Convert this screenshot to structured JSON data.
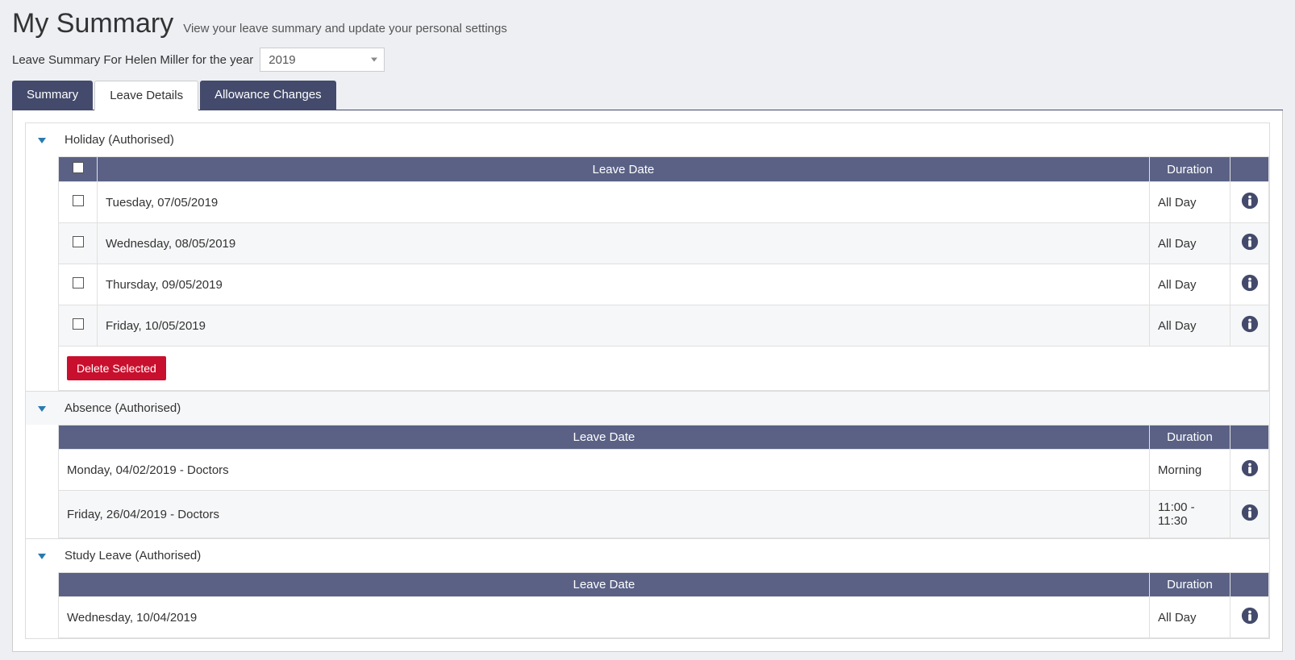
{
  "header": {
    "title": "My Summary",
    "subtitle": "View your leave summary and update your personal settings"
  },
  "summary_for": {
    "label_prefix": "Leave Summary For Helen Miller for the year",
    "year": "2019"
  },
  "tabs": {
    "summary": "Summary",
    "leave_details": "Leave Details",
    "allowance_changes": "Allowance Changes"
  },
  "columns": {
    "leave_date": "Leave Date",
    "duration": "Duration"
  },
  "buttons": {
    "delete_selected": "Delete Selected"
  },
  "groups": [
    {
      "title": "Holiday (Authorised)",
      "has_checkbox": true,
      "has_delete": true,
      "rows": [
        {
          "date": "Tuesday, 07/05/2019",
          "duration": "All Day"
        },
        {
          "date": "Wednesday, 08/05/2019",
          "duration": "All Day"
        },
        {
          "date": "Thursday, 09/05/2019",
          "duration": "All Day"
        },
        {
          "date": "Friday, 10/05/2019",
          "duration": "All Day"
        }
      ]
    },
    {
      "title": "Absence (Authorised)",
      "has_checkbox": false,
      "has_delete": false,
      "gray": true,
      "rows": [
        {
          "date": "Monday, 04/02/2019 - Doctors",
          "duration": "Morning"
        },
        {
          "date": "Friday, 26/04/2019 - Doctors",
          "duration": "11:00 - 11:30"
        }
      ]
    },
    {
      "title": "Study Leave (Authorised)",
      "has_checkbox": false,
      "has_delete": false,
      "rows": [
        {
          "date": "Wednesday, 10/04/2019",
          "duration": "All Day"
        }
      ]
    }
  ]
}
